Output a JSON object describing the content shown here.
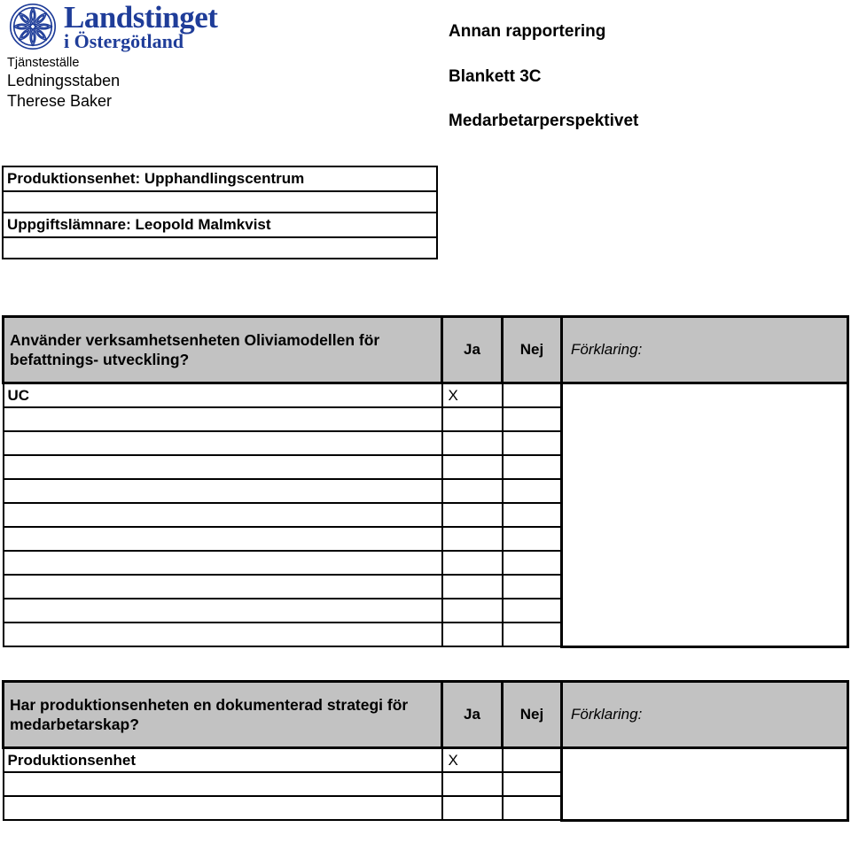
{
  "header": {
    "logo": {
      "icon": "landstinget-rosette-logo",
      "line1": "Landstinget",
      "line2": "i Östergötland",
      "color": "#1f3d99"
    },
    "workplace_label": "Tjänsteställe",
    "workplace_value": "Ledningsstaben",
    "person_value": "Therese Baker",
    "right_line1": "Annan rapportering",
    "right_line2": "Blankett 3C",
    "right_line3": "Medarbetarperspektivet"
  },
  "info_rows": [
    {
      "text": "Produktionsenhet: Upphandlingscentrum"
    },
    {
      "text": ""
    },
    {
      "text": "Uppgiftslämnare: Leopold Malmkvist"
    },
    {
      "text": ""
    }
  ],
  "questions": [
    {
      "question": "Använder verksamhetsenheten Oliviamodellen för befattnings- utveckling?",
      "col_ja": "Ja",
      "col_nej": "Nej",
      "col_forklaring": "Förklaring:",
      "rows": [
        {
          "label": "UC",
          "ja": "X",
          "nej": ""
        },
        {
          "label": "",
          "ja": "",
          "nej": ""
        },
        {
          "label": "",
          "ja": "",
          "nej": ""
        },
        {
          "label": "",
          "ja": "",
          "nej": ""
        },
        {
          "label": "",
          "ja": "",
          "nej": ""
        },
        {
          "label": "",
          "ja": "",
          "nej": ""
        },
        {
          "label": "",
          "ja": "",
          "nej": ""
        },
        {
          "label": "",
          "ja": "",
          "nej": ""
        },
        {
          "label": "",
          "ja": "",
          "nej": ""
        },
        {
          "label": "",
          "ja": "",
          "nej": ""
        },
        {
          "label": "",
          "ja": "",
          "nej": ""
        }
      ],
      "forklaring_value": ""
    },
    {
      "question": "Har produktionsenheten en dokumenterad strategi för medarbetarskap?",
      "col_ja": "Ja",
      "col_nej": "Nej",
      "col_forklaring": "Förklaring:",
      "rows": [
        {
          "label": "Produktionsenhet",
          "ja": "X",
          "nej": ""
        },
        {
          "label": "",
          "ja": "",
          "nej": ""
        },
        {
          "label": "",
          "ja": "",
          "nej": ""
        }
      ],
      "forklaring_value": ""
    }
  ],
  "colors": {
    "header_fill": "#c2c2c2",
    "border": "#000000",
    "logo_blue": "#1f3d99"
  }
}
